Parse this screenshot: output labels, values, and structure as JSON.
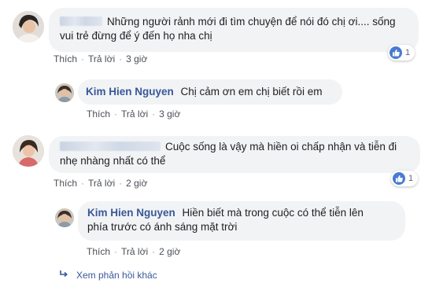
{
  "comments": [
    {
      "text": "Những người rảnh mới đi tìm chuyện để nói đó chị ơi.... sống vui trẻ đừng để ý đến họ nha chị",
      "line1": "Những người rảnh mới đi tìm chuyện để nói đó chị ơi.... sống",
      "line2": "vui trẻ đừng để ý đến họ nha chị",
      "like_label": "Thích",
      "reply_label": "Trả lời",
      "time": "3 giờ",
      "reaction_count": "1"
    },
    {
      "author": "Kim Hien Nguyen",
      "text": "Chị cảm ơn em chị biết rồi em",
      "like_label": "Thích",
      "reply_label": "Trả lời",
      "time": "3 giờ"
    },
    {
      "text": "Cuộc sống là vậy mà hiền oi chấp nhận và tiễn đi nhẹ nhàng nhất có thể",
      "line1": "Cuộc sống là vậy mà hiền oi chấp nhận và tiễn đi",
      "line2": "nhẹ nhàng nhất có thể",
      "like_label": "Thích",
      "reply_label": "Trả lời",
      "time": "2 giờ",
      "reaction_count": "1"
    },
    {
      "author": "Kim Hien Nguyen",
      "text": "Hiền biết mà trong cuộc có thể tiễn lên phía trước có ánh sáng mặt trời",
      "line1": "Hiền biết mà trong cuộc có thể tiễn lên",
      "line2": "phía trước có ánh sáng mặt trời",
      "like_label": "Thích",
      "reply_label": "Trả lời",
      "time": "2 giờ"
    }
  ],
  "more_replies": {
    "label": "Xem phản hồi khác",
    "icon": "reply-arrow-icon"
  },
  "colors": {
    "bubble": "#f2f3f5",
    "name": "#385898",
    "like": "#4a7bd1"
  }
}
